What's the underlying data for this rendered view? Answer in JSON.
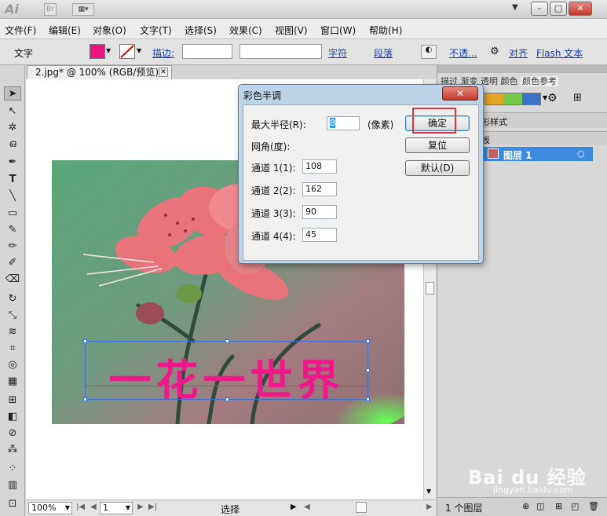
{
  "app": {
    "logo": "Ai",
    "bridge": "Br"
  },
  "menu": [
    "文件(F)",
    "编辑(E)",
    "对象(O)",
    "文字(T)",
    "选择(S)",
    "效果(C)",
    "视图(V)",
    "窗口(W)",
    "帮助(H)"
  ],
  "control": {
    "tool_name": "文字",
    "stroke_label": "描边:",
    "char_link": "字符",
    "para_link": "段落",
    "opacity_link": "不透...",
    "align_link": "对齐",
    "flash_link": "Flash 文本",
    "fill_color": "#e8157f"
  },
  "document": {
    "tab_title": "2.jpg* @ 100% (RGB/预览)",
    "artwork_text": "一花一世界",
    "text_color": "#f0188a"
  },
  "dialog": {
    "title": "彩色半调",
    "max_radius_label": "最大半径(R):",
    "max_radius_value": "8",
    "max_radius_unit": "(像素)",
    "screen_angle_label": "网角(度):",
    "channels": [
      {
        "label": "通道 1(1):",
        "value": "108"
      },
      {
        "label": "通道 2(2):",
        "value": "162"
      },
      {
        "label": "通道 3(3):",
        "value": "90"
      },
      {
        "label": "通道 4(4):",
        "value": "45"
      }
    ],
    "ok_button": "确定",
    "reset_button": "复位",
    "default_button": "默认(D)",
    "highlight_color": "#d9363e"
  },
  "right_panel": {
    "tabs": [
      "描过",
      "渐变",
      "透明",
      "颜色",
      "颜色参考"
    ],
    "styles_label": "形样式",
    "layers_tab": "板",
    "layer_name": "图层 1",
    "layer_count": "1 个图层",
    "layer_color": "#4a90e2"
  },
  "statusbar": {
    "zoom": "100%",
    "page": "1",
    "mode": "选择"
  },
  "watermark": {
    "brand": "Bai du 经验",
    "url": "jingyan.baidu.com"
  }
}
